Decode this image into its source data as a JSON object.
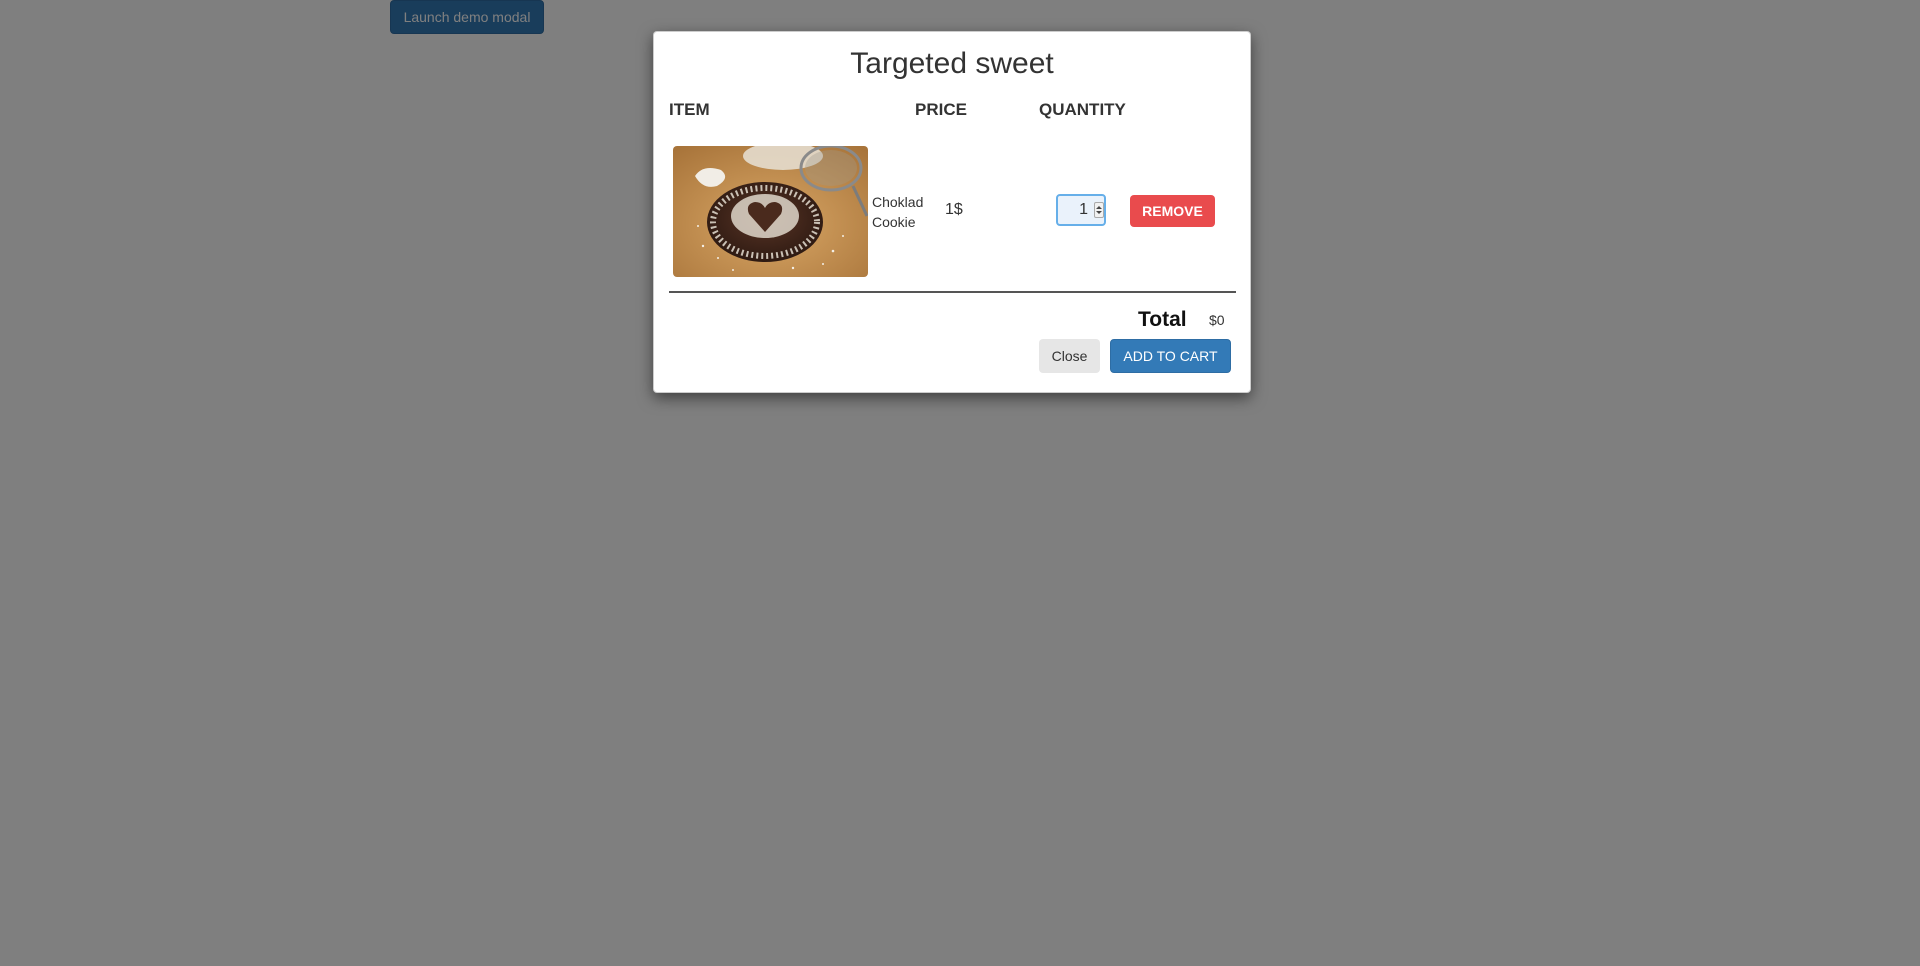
{
  "page": {
    "launch_button_label": "Launch demo modal"
  },
  "modal": {
    "title": "Targeted sweet",
    "columns": [
      "ITEM",
      "PRICE",
      "QUANTITY"
    ],
    "item": {
      "name": "Choklad Cookie",
      "price": "1$",
      "quantity": "1",
      "remove_label": "REMOVE",
      "image_icon": "chocolate-cookie-photo"
    },
    "total_label": "Total",
    "total_value": "$0",
    "close_label": "Close",
    "add_to_cart_label": "ADD TO CART"
  },
  "colors": {
    "primary": "#337ab7",
    "danger": "#e94b4d",
    "backdrop": "rgba(0,0,0,0.5)"
  }
}
